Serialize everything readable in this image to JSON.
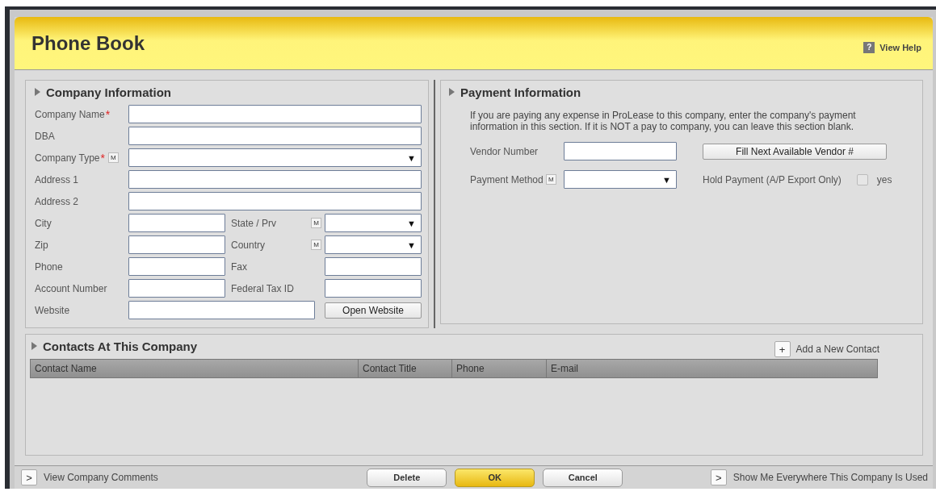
{
  "header": {
    "title": "Phone Book",
    "help_icon": "?",
    "help_label": "View Help"
  },
  "company_info": {
    "title": "Company Information",
    "rows": [
      {
        "kind": "wide",
        "fields": [
          {
            "label": "Company Name",
            "required_mark": "*",
            "kind": "text"
          }
        ]
      },
      {
        "kind": "wide",
        "fields": [
          {
            "label": "DBA",
            "kind": "text"
          }
        ]
      },
      {
        "kind": "wide",
        "fields": [
          {
            "label": "Company Type",
            "required_mark": "*",
            "multi": "M",
            "kind": "select",
            "arrow": "▼"
          }
        ]
      },
      {
        "kind": "wide",
        "fields": [
          {
            "label": "Address 1",
            "kind": "text"
          }
        ]
      },
      {
        "kind": "wide",
        "fields": [
          {
            "label": "Address 2",
            "kind": "text"
          }
        ]
      },
      {
        "kind": "split",
        "fields": [
          {
            "label": "City",
            "kind": "text"
          },
          {
            "label": "State / Prv",
            "multi": "M",
            "kind": "select",
            "arrow": "▼"
          }
        ]
      },
      {
        "kind": "split",
        "fields": [
          {
            "label": "Zip",
            "kind": "text"
          },
          {
            "label": "Country",
            "multi": "M",
            "kind": "select",
            "arrow": "▼"
          }
        ]
      },
      {
        "kind": "split",
        "fields": [
          {
            "label": "Phone",
            "kind": "text"
          },
          {
            "label": "Fax",
            "kind": "text"
          }
        ]
      },
      {
        "kind": "split",
        "fields": [
          {
            "label": "Account Number",
            "kind": "text"
          },
          {
            "label": "Federal Tax ID",
            "kind": "text"
          }
        ]
      },
      {
        "kind": "website",
        "fields": [
          {
            "label": "Website",
            "kind": "text"
          }
        ],
        "button": "Open Website"
      }
    ]
  },
  "payment_info": {
    "title": "Payment Information",
    "description": "If you are paying any expense in ProLease to this company, enter the company's payment information in this section. If it is NOT a pay to company, you can leave this section blank.",
    "vendor_label": "Vendor Number",
    "fill_button": "Fill Next Available Vendor #",
    "method_label": "Payment Method",
    "method_multi": "M",
    "method_arrow": "▼",
    "hold_label": "Hold Payment (A/P Export Only)",
    "hold": {
      "checked": false,
      "label": "yes"
    }
  },
  "contacts": {
    "title": "Contacts At This Company",
    "add_icon": "+",
    "add_label": "Add a New Contact",
    "columns": [
      "Contact Name",
      "Contact Title",
      "Phone",
      "E-mail"
    ]
  },
  "footer": {
    "left": {
      "icon": ">",
      "label": "View Company Comments"
    },
    "buttons": [
      {
        "label": "Delete",
        "kind": "normal"
      },
      {
        "label": "OK",
        "kind": "primary"
      },
      {
        "label": "Cancel",
        "kind": "normal"
      }
    ],
    "right": {
      "icon": ">",
      "label": "Show Me Everywhere This Company Is Used"
    }
  }
}
